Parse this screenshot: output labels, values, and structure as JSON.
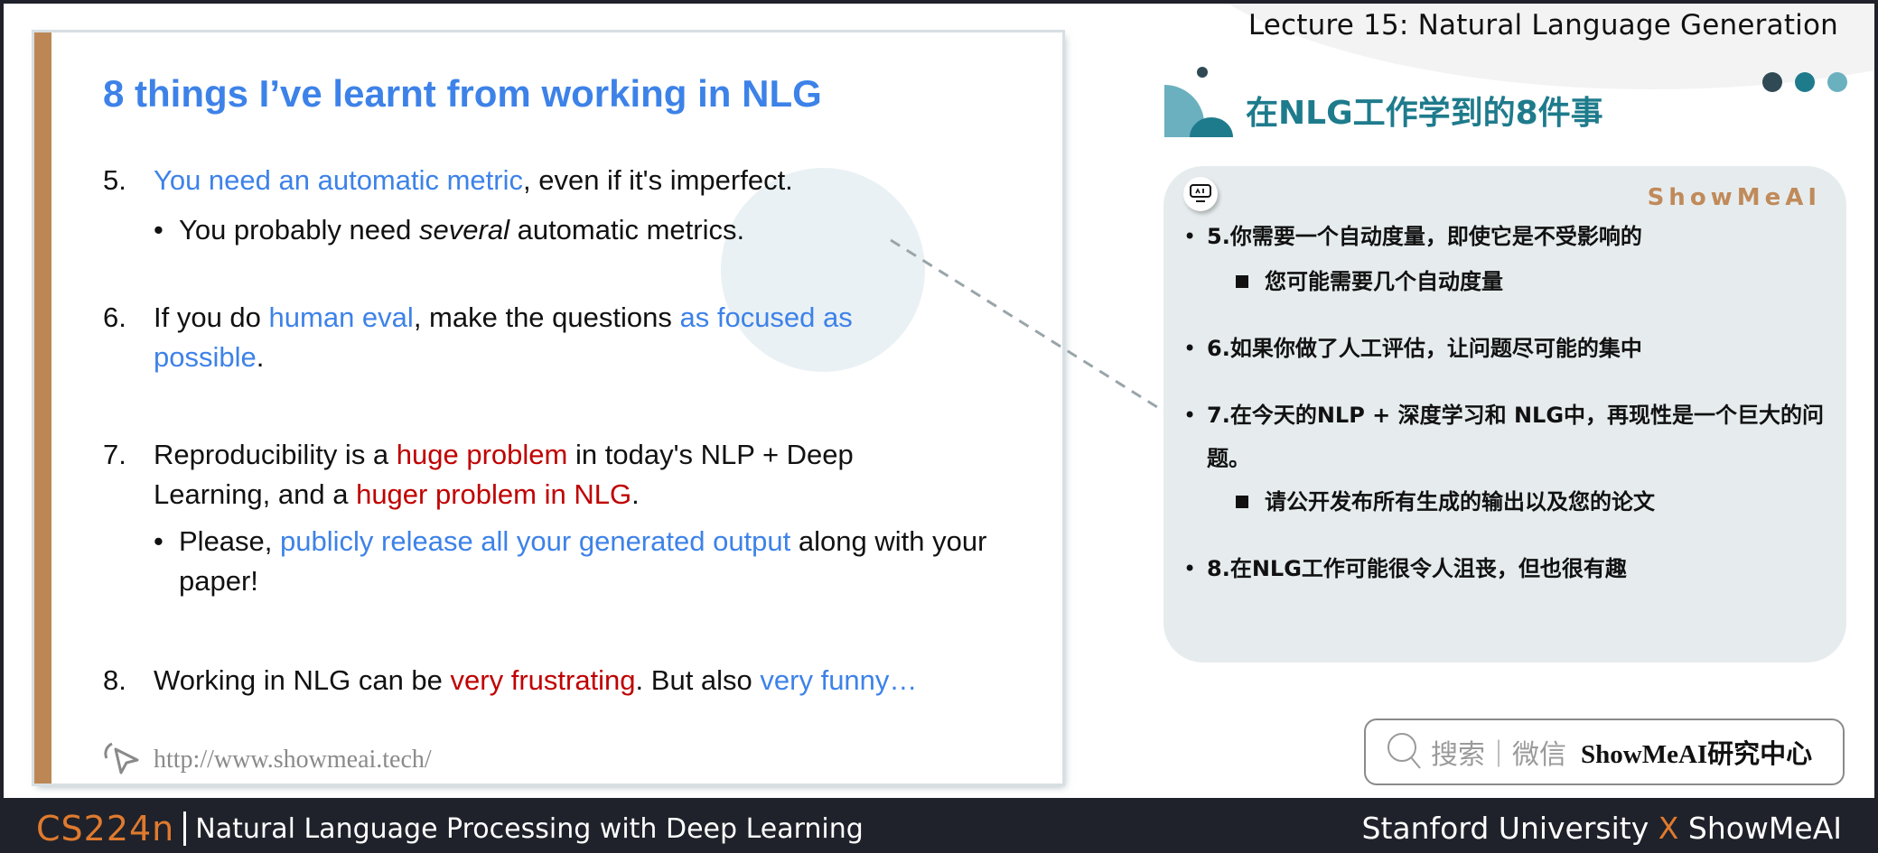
{
  "header": {
    "lecture_title": "Lecture 15: Natural Language Generation"
  },
  "slide": {
    "title": "8 things I’ve learnt from working in NLG",
    "items": [
      {
        "number": "5.",
        "segments": [
          {
            "text": "You need an automatic metric",
            "style": "blue"
          },
          {
            "text": ", even if it's imperfect.",
            "style": "normal"
          }
        ],
        "sub": [
          {
            "bullet": "•",
            "segments": [
              {
                "text": "You probably need ",
                "style": "normal"
              },
              {
                "text": "several",
                "style": "italic"
              },
              {
                "text": " automatic metrics.",
                "style": "normal"
              }
            ]
          }
        ]
      },
      {
        "number": "6.",
        "segments": [
          {
            "text": "If you do ",
            "style": "normal"
          },
          {
            "text": "human eval",
            "style": "blue"
          },
          {
            "text": ", make the questions ",
            "style": "normal"
          },
          {
            "text": "as focused as possible",
            "style": "blue"
          },
          {
            "text": ".",
            "style": "normal"
          }
        ]
      },
      {
        "number": "7.",
        "segments": [
          {
            "text": "Reproducibility is a ",
            "style": "normal"
          },
          {
            "text": "huge problem",
            "style": "red"
          },
          {
            "text": " in today's NLP + Deep Learning, and a ",
            "style": "normal"
          },
          {
            "text": "huger problem in NLG",
            "style": "red"
          },
          {
            "text": ".",
            "style": "normal"
          }
        ],
        "sub": [
          {
            "bullet": "•",
            "segments": [
              {
                "text": "Please, ",
                "style": "normal"
              },
              {
                "text": "publicly release all your generated output",
                "style": "blue"
              },
              {
                "text": " along with your paper!",
                "style": "normal"
              }
            ]
          }
        ]
      },
      {
        "number": "8.",
        "segments": [
          {
            "text": "Working in NLG can be ",
            "style": "normal"
          },
          {
            "text": "very frustrating",
            "style": "red"
          },
          {
            "text": ". But also ",
            "style": "normal"
          },
          {
            "text": "very funny…",
            "style": "blue"
          }
        ]
      }
    ],
    "url": "http://www.showmeai.tech/",
    "icons": {
      "url_icon": "cursor-click-icon"
    }
  },
  "panel": {
    "title": "在NLG工作学到的8件事",
    "brand": "ShowMeAI",
    "items": [
      {
        "bullet": "•",
        "text": "5.你需要一个自动度量，即使它是不受影响的"
      },
      {
        "bullet": "■",
        "text": "您可能需要几个自动度量",
        "level": 2
      },
      {
        "bullet": "•",
        "text": "6.如果你做了人工评估，让问题尽可能的集中"
      },
      {
        "bullet": "•",
        "text": "7.在今天的NLP + 深度学习和 NLG中，再现性是一个巨大的问题。"
      },
      {
        "bullet": "■",
        "text": "请公开发布所有生成的输出以及您的论文",
        "level": 2
      },
      {
        "bullet": "•",
        "text": "8.在NLG工作可能很令人沮丧，但也很有趣"
      }
    ],
    "dot_colors": [
      "#2f4a55",
      "#1e7b8c",
      "#6bb0bf"
    ]
  },
  "search": {
    "placeholder": "搜索｜微信",
    "brand_text": "ShowMeAI研究中心"
  },
  "footer": {
    "course_code": "CS224n",
    "course_name": "Natural Language Processing with Deep Learning",
    "right_a": "Stanford University",
    "right_x": "X",
    "right_b": "ShowMeAI"
  },
  "colors": {
    "accent_blue": "#3d82e8",
    "accent_red": "#c00000",
    "teal": "#1e7b8c",
    "orange": "#e07a2e",
    "slide_bar": "#bd8755",
    "footer_bg": "#1f222a"
  }
}
